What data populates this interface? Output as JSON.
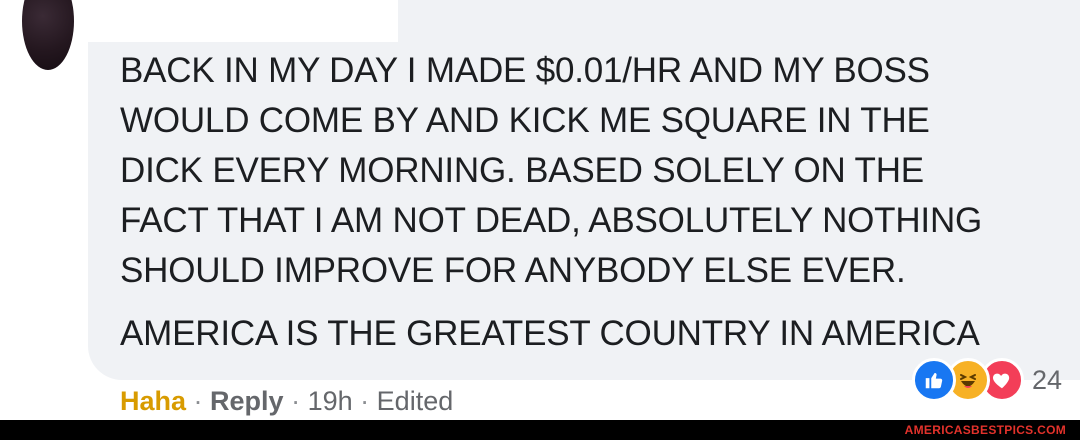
{
  "comment": {
    "lines": [
      "BACK IN MY DAY I MADE $0.01/HR AND MY BOSS",
      "WOULD COME BY AND KICK ME SQUARE IN THE",
      "DICK EVERY MORNING. BASED SOLELY ON THE",
      "FACT THAT I AM NOT DEAD, ABSOLUTELY NOTHING",
      "SHOULD IMPROVE FOR ANYBODY ELSE EVER.",
      "AMERICA IS THE GREATEST COUNTRY IN AMERICA"
    ]
  },
  "actions": {
    "reaction_label": "Haha",
    "separator": "·",
    "reply_label": "Reply",
    "time": "19h",
    "edited_label": "Edited"
  },
  "reactions": {
    "icons": [
      "like-icon",
      "haha-icon",
      "love-icon"
    ],
    "count": "24"
  },
  "watermark": "AMERICASBESTPICS.COM",
  "colors": {
    "bubble": "#f0f2f5",
    "haha_label": "#d89b00",
    "meta_text": "#65676b",
    "like": "#1877f2",
    "haha": "#f7b125",
    "love": "#f33e58",
    "watermark": "#e3322b"
  }
}
